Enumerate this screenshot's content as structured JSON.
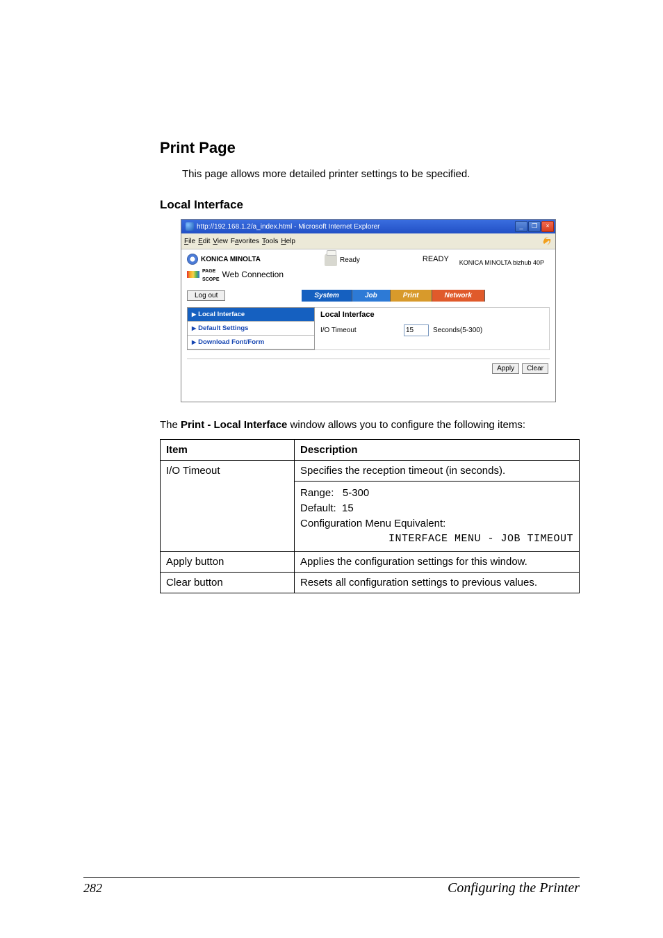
{
  "headings": {
    "print_page": "Print Page",
    "local_interface": "Local Interface"
  },
  "intro_text": "This page allows more detailed printer settings to be specified.",
  "browser": {
    "titlebar": "http://192.168.1.2/a_index.html - Microsoft Internet Explorer",
    "win_min": "_",
    "win_max": "❐",
    "win_close": "×",
    "menus": {
      "file": "File",
      "edit": "Edit",
      "view": "View",
      "favorites": "Favorites",
      "tools": "Tools",
      "help": "Help"
    },
    "brand": {
      "km": "KONICA MINOLTA",
      "pagescope_prefix": "PAGE SCOPE",
      "pagescope": "Web Connection"
    },
    "status_ready_small": "Ready",
    "status_ready_big": "READY",
    "model": "KONICA MINOLTA bizhub 40P",
    "logout": "Log out",
    "tabs": {
      "system": "System",
      "job": "Job",
      "print": "Print",
      "network": "Network"
    },
    "sidebar": {
      "local_interface": "Local Interface",
      "default_settings": "Default Settings",
      "download_font_form": "Download Font/Form"
    },
    "pane": {
      "title": "Local Interface",
      "field_label": "I/O Timeout",
      "field_value": "15",
      "field_suffix": "Seconds(5-300)"
    },
    "buttons": {
      "apply": "Apply",
      "clear": "Clear"
    }
  },
  "after_text_1": "The ",
  "after_text_2": "Print - Local Interface",
  "after_text_3": " window allows you to configure the following items:",
  "table": {
    "header_item": "Item",
    "header_desc": "Description",
    "rows": [
      {
        "item": "I/O Timeout",
        "desc_line1": "Specifies the reception timeout (in seconds).",
        "range": "Range:   5-300",
        "default": "Default:  15",
        "cme": "Configuration Menu Equivalent:",
        "mono": "INTERFACE MENU - JOB TIMEOUT"
      },
      {
        "item": "Apply button",
        "desc": "Applies the configuration settings for this window."
      },
      {
        "item": "Clear button",
        "desc": "Resets all configuration settings to previous values."
      }
    ]
  },
  "footer": {
    "page_num": "282",
    "text": "Configuring the Printer"
  }
}
